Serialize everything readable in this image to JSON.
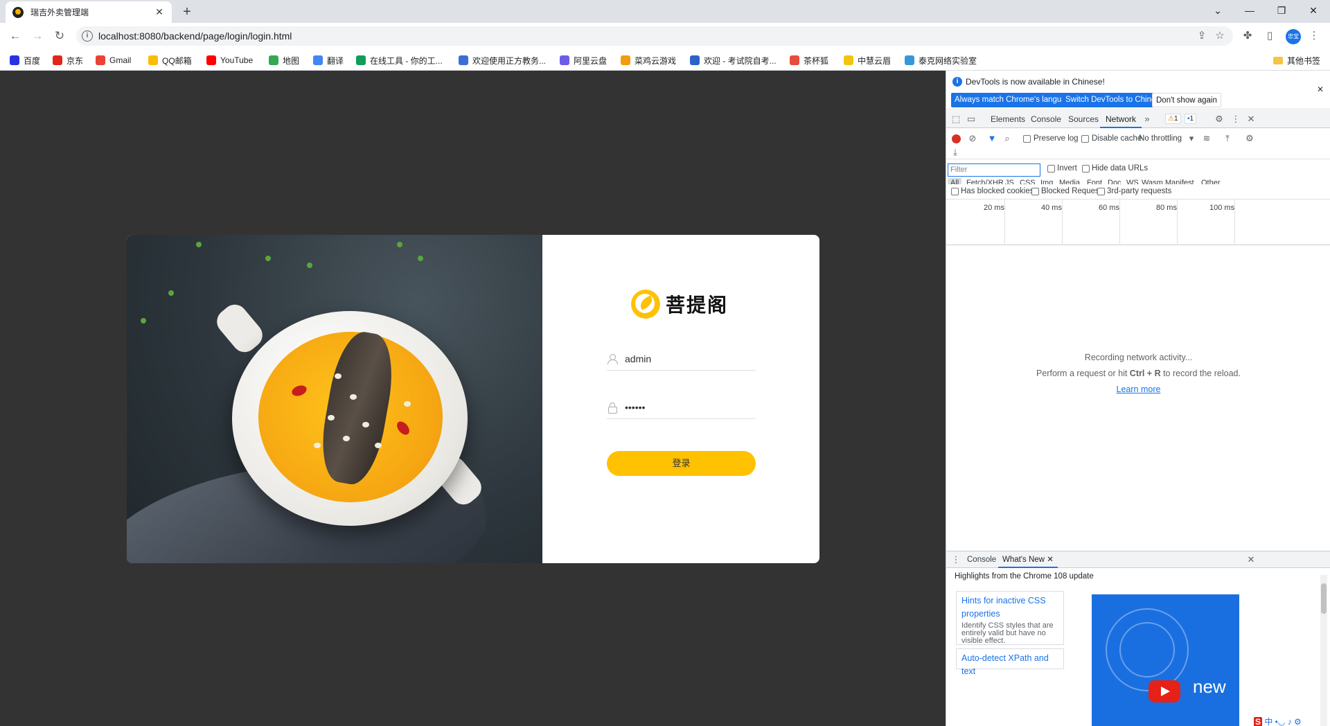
{
  "browser": {
    "tab": {
      "title": "瑞吉外卖管理端"
    },
    "url": "localhost:8080/backend/page/login/login.html",
    "profile_label": "忠宝",
    "bookmarks": [
      {
        "label": "百度",
        "color": "#2932e1"
      },
      {
        "label": "京东",
        "color": "#e1251b"
      },
      {
        "label": "Gmail",
        "color": "#ea4335"
      },
      {
        "label": "QQ邮箱",
        "color": "#fbbc05"
      },
      {
        "label": "YouTube",
        "color": "#ff0000"
      },
      {
        "label": "地图",
        "color": "#34a853"
      },
      {
        "label": "翻译",
        "color": "#4285f4"
      },
      {
        "label": "在线工具 - 你的工...",
        "color": "#0f9d58"
      },
      {
        "label": "欢迎使用正方教务...",
        "color": "#3b6fd8"
      },
      {
        "label": "阿里云盘",
        "color": "#6c5ce7"
      },
      {
        "label": "菜鸡云游戏",
        "color": "#f39c12"
      },
      {
        "label": "欢迎 - 考试院自考...",
        "color": "#2a62c9"
      },
      {
        "label": "茶杯狐",
        "color": "#e74c3c"
      },
      {
        "label": "中慧云眉",
        "color": "#f1c40f"
      },
      {
        "label": "泰克网络实验室",
        "color": "#3498db"
      }
    ],
    "other_bookmarks": "其他书签"
  },
  "login": {
    "brand": "菩提阁",
    "username": "admin",
    "password_mask": "••••••",
    "submit_label": "登录"
  },
  "devtools": {
    "infobar": {
      "message": "DevTools is now available in Chinese!",
      "btn_match": "Always match Chrome's language",
      "btn_switch": "Switch DevTools to Chinese",
      "btn_dismiss": "Don't show again"
    },
    "tabs": [
      "Elements",
      "Console",
      "Sources",
      "Network"
    ],
    "active_tab": "Network",
    "warnings_count": "1",
    "messages_count": "1",
    "toolbar": {
      "preserve_log": "Preserve log",
      "disable_cache": "Disable cache",
      "throttling": "No throttling"
    },
    "filter": {
      "placeholder": "Filter",
      "invert": "Invert",
      "hide_data_urls": "Hide data URLs"
    },
    "types": [
      "All",
      "Fetch/XHR",
      "JS",
      "CSS",
      "Img",
      "Media",
      "Font",
      "Doc",
      "WS",
      "Wasm",
      "Manifest",
      "Other"
    ],
    "blocked": {
      "has_blocked_cookies": "Has blocked cookies",
      "blocked_requests": "Blocked Requests",
      "third_party": "3rd-party requests"
    },
    "timeline_labels": [
      "20 ms",
      "40 ms",
      "60 ms",
      "80 ms",
      "100 ms"
    ],
    "empty": {
      "line1": "Recording network activity...",
      "line2_pre": "Perform a request or hit ",
      "line2_key": "Ctrl + R",
      "line2_post": " to record the reload.",
      "learn_more": "Learn more"
    },
    "drawer": {
      "tabs": [
        "Console",
        "What's New"
      ],
      "active_tab": "What's New",
      "highlights": "Highlights from the Chrome 108 update",
      "cards": [
        {
          "title": "Hints for inactive CSS properties",
          "desc": "Identify CSS styles that are entirely valid but have no visible effect."
        },
        {
          "title": "Auto-detect XPath and text",
          "desc": ""
        }
      ],
      "video_text": "new"
    }
  }
}
